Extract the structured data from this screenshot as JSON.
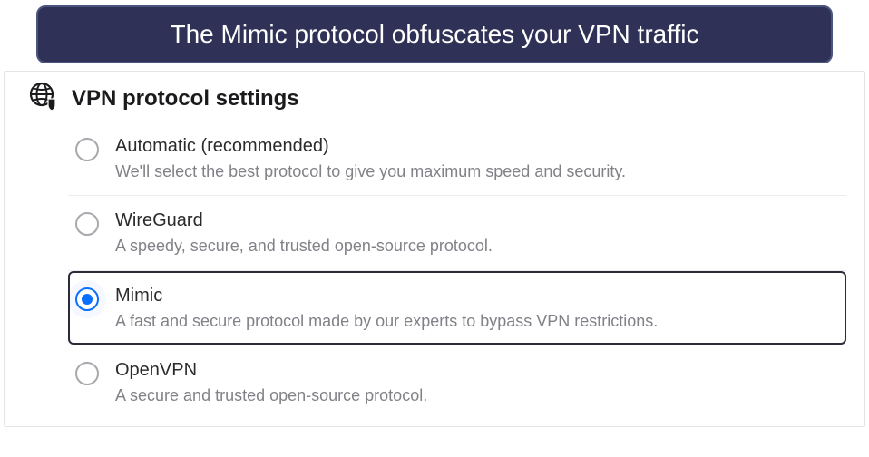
{
  "banner": {
    "text": "The Mimic protocol obfuscates your VPN traffic"
  },
  "settings": {
    "title": "VPN protocol settings",
    "options": [
      {
        "label": "Automatic (recommended)",
        "desc": "We'll select the best protocol to give you maximum speed and security.",
        "selected": false
      },
      {
        "label": "WireGuard",
        "desc": "A speedy, secure, and trusted open-source protocol.",
        "selected": false
      },
      {
        "label": "Mimic",
        "desc": "A fast and secure protocol made by our experts to bypass VPN restrictions.",
        "selected": true
      },
      {
        "label": "OpenVPN",
        "desc": "A secure and trusted open-source protocol.",
        "selected": false
      }
    ]
  }
}
